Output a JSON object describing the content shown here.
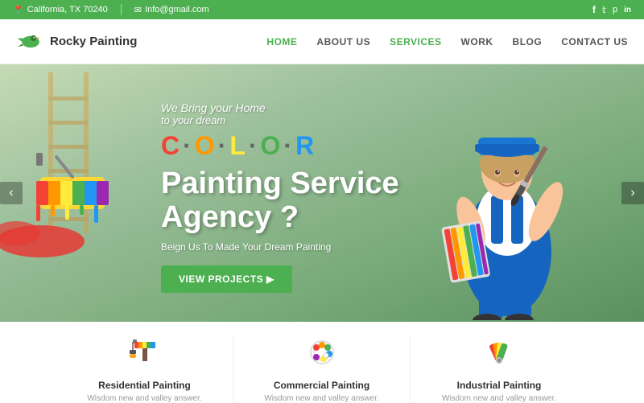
{
  "topbar": {
    "location": "California, TX 70240",
    "email": "Info@gmail.com",
    "social": [
      "f",
      "t",
      "p",
      "in"
    ]
  },
  "logo": {
    "name": "Rocky Painting"
  },
  "nav": {
    "links": [
      {
        "label": "HOME",
        "active": true
      },
      {
        "label": "ABOUT US",
        "active": false
      },
      {
        "label": "SERVICES",
        "active": false
      },
      {
        "label": "WORK",
        "active": false
      },
      {
        "label": "BLOG",
        "active": false
      },
      {
        "label": "CONTACT US",
        "active": false
      }
    ]
  },
  "hero": {
    "color_prefix": "We Bring your Home",
    "color_prefix2": "to your dream",
    "color_word": "C·O·L·O·R",
    "title_line1": "Painting Service",
    "title_line2": "Agency ?",
    "subtitle": "Beign Us To Made Your Dream Painting",
    "btn_label": "VIEW PROJECTS ▶"
  },
  "services": [
    {
      "icon": "🖌️",
      "title": "Residential Painting",
      "desc": "Wisdom new and valley answer."
    },
    {
      "icon": "🎨",
      "title": "Commercial Painting",
      "desc": "Wisdom new and valley answer."
    },
    {
      "icon": "🖼️",
      "title": "Industrial Painting",
      "desc": "Wisdom new and valley answer."
    }
  ],
  "colors": {
    "green": "#4caf50",
    "dark": "#333333",
    "light_gray": "#f5f5f5"
  }
}
